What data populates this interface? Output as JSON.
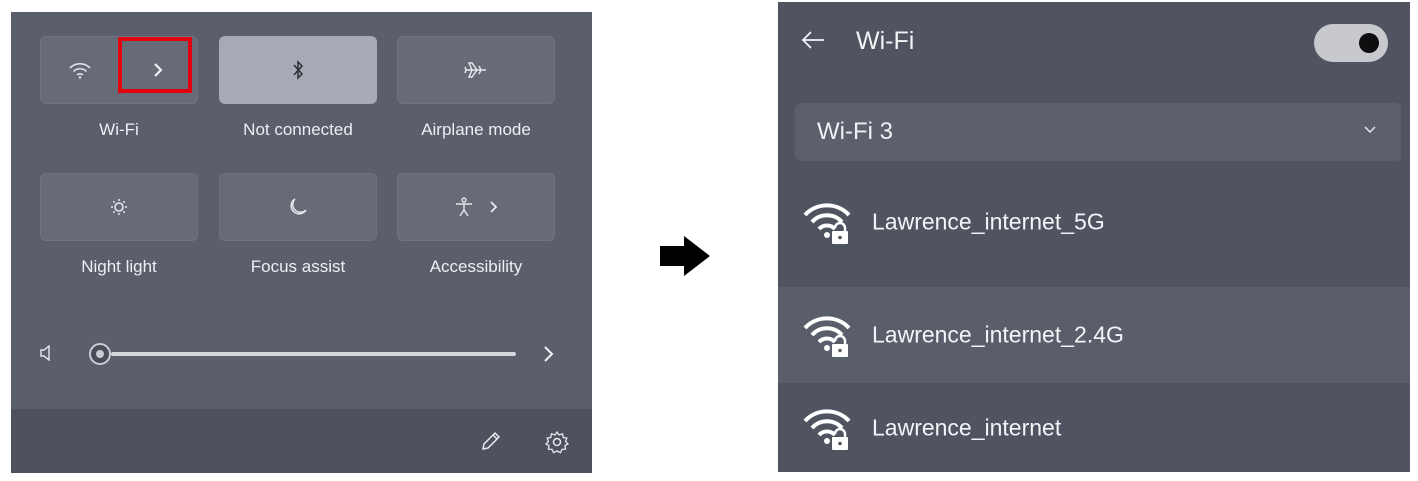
{
  "quick_settings": {
    "tiles": [
      {
        "id": "wifi",
        "label": "Wi-Fi",
        "icon": "wifi-icon",
        "active": false,
        "has_chevron": true
      },
      {
        "id": "bluetooth",
        "label": "Not connected",
        "icon": "bluetooth-icon",
        "active": true
      },
      {
        "id": "airplane",
        "label": "Airplane mode",
        "icon": "airplane-icon",
        "active": false
      },
      {
        "id": "night_light",
        "label": "Night light",
        "icon": "sun-icon",
        "active": false
      },
      {
        "id": "focus_assist",
        "label": "Focus assist",
        "icon": "moon-icon",
        "active": false
      },
      {
        "id": "accessibility",
        "label": "Accessibility",
        "icon": "accessibility-icon",
        "active": false,
        "has_chevron": true
      }
    ],
    "volume": {
      "level": 0.0,
      "icon": "speaker-icon"
    },
    "footer_icons": [
      "pencil-icon",
      "gear-icon"
    ],
    "highlight_color": "#e3000f"
  },
  "transition_arrow": "right-arrow",
  "wifi_panel": {
    "title": "Wi-Fi",
    "toggle_on": true,
    "connected_network": "Wi-Fi 3",
    "networks": [
      {
        "name": "Lawrence_internet_5G",
        "secured": true,
        "selected": false
      },
      {
        "name": "Lawrence_internet_2.4G",
        "secured": true,
        "selected": true
      },
      {
        "name": "Lawrence_internet",
        "secured": true,
        "selected": false
      }
    ]
  },
  "colors": {
    "panel_bg": "#5b5e6b",
    "tile_bg": "#676a77",
    "tile_active_bg": "#a5aab5",
    "wifi_panel_bg": "#505461"
  }
}
